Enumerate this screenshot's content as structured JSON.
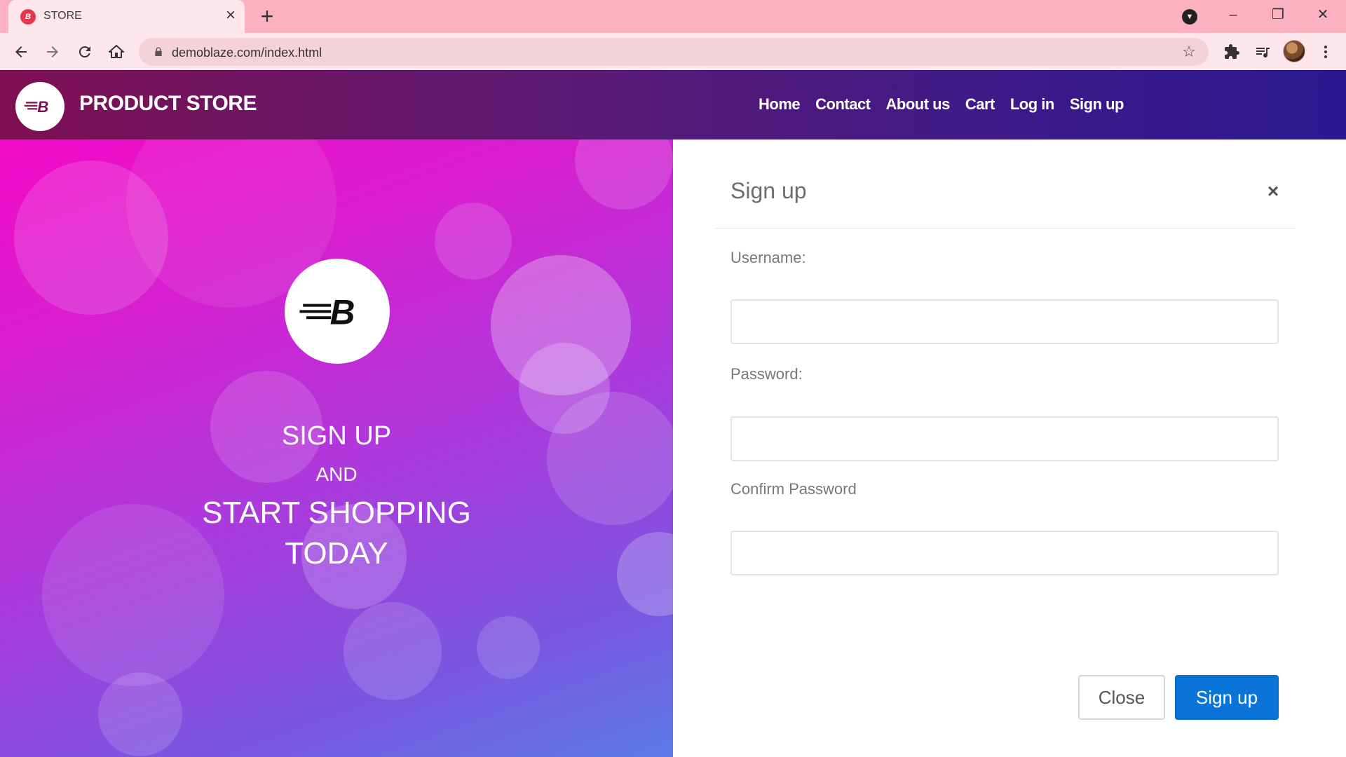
{
  "browser": {
    "tab": {
      "title": "STORE",
      "favicon": "B"
    },
    "url": "demoblaze.com/index.html",
    "icons": {
      "tab_close": "close-icon",
      "new_tab": "plus-icon",
      "back": "arrow-left-icon",
      "forward": "arrow-right-icon",
      "reload": "reload-icon",
      "home": "home-icon",
      "lock": "lock-icon",
      "bookmark": "star-icon",
      "extensions": "puzzle-icon",
      "media": "media-queue-icon",
      "menu": "kebab-menu-icon"
    }
  },
  "site_nav": {
    "brand": "PRODUCT STORE",
    "links": [
      "Home",
      "Contact",
      "About us",
      "Cart",
      "Log in",
      "Sign up"
    ]
  },
  "hero": {
    "line1": "SIGN UP",
    "line2": "AND",
    "line3": "START SHOPPING",
    "line4": "TODAY"
  },
  "modal": {
    "title": "Sign up",
    "username_label": "Username:",
    "username_value": "",
    "password_label": "Password:",
    "password_value": "",
    "confirm_label": "Confirm Password",
    "confirm_value": "",
    "close_label": "Close",
    "submit_label": "Sign up"
  },
  "colors": {
    "tabstrip": "#fbb1c2",
    "toolbar": "#fde6ec",
    "primary_button": "#0b74d8",
    "nav_gradient_start": "#7e1052",
    "nav_gradient_end": "#2a1890"
  }
}
